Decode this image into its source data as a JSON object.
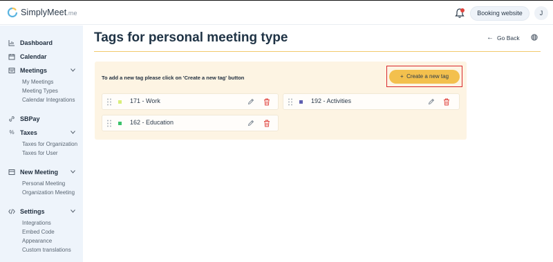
{
  "header": {
    "logo_text": "SimplyMeet",
    "logo_suffix": ".me",
    "booking_button": "Booking website",
    "avatar_initial": "J"
  },
  "sidebar": {
    "sections": [
      {
        "label": "Dashboard",
        "icon": "chart-icon"
      },
      {
        "label": "Calendar",
        "icon": "calendar-icon"
      },
      {
        "label": "Meetings",
        "icon": "meetings-icon",
        "children": [
          "My Meetings",
          "Meeting Types",
          "Calendar Integrations"
        ]
      },
      {
        "label": "SBPay",
        "icon": "link-icon"
      },
      {
        "label": "Taxes",
        "icon": "percent-icon",
        "children": [
          "Taxes for Organization",
          "Taxes for User"
        ]
      },
      {
        "label": "New Meeting",
        "icon": "new-meeting-icon",
        "children": [
          "Personal Meeting",
          "Organization Meeting"
        ]
      },
      {
        "label": "Settings",
        "icon": "code-icon",
        "children": [
          "Integrations",
          "Embed Code",
          "Appearance",
          "Custom translations"
        ]
      }
    ]
  },
  "page": {
    "title": "Tags for personal meeting type",
    "go_back": "Go Back",
    "hint": "To add a new tag please click on 'Create a new tag' button",
    "create_button": "Create a new tag",
    "create_button_icon": "+"
  },
  "tags": [
    {
      "label": "171 - Work",
      "color": "#d9ee7a"
    },
    {
      "label": "192 - Activities",
      "color": "#5e5fb0"
    },
    {
      "label": "162 - Education",
      "color": "#3cc26a"
    }
  ],
  "colors": {
    "accent": "#f3c04d",
    "highlight": "#d9252a",
    "delete": "#e0443e",
    "sidebar_bg": "#eef4fb"
  }
}
